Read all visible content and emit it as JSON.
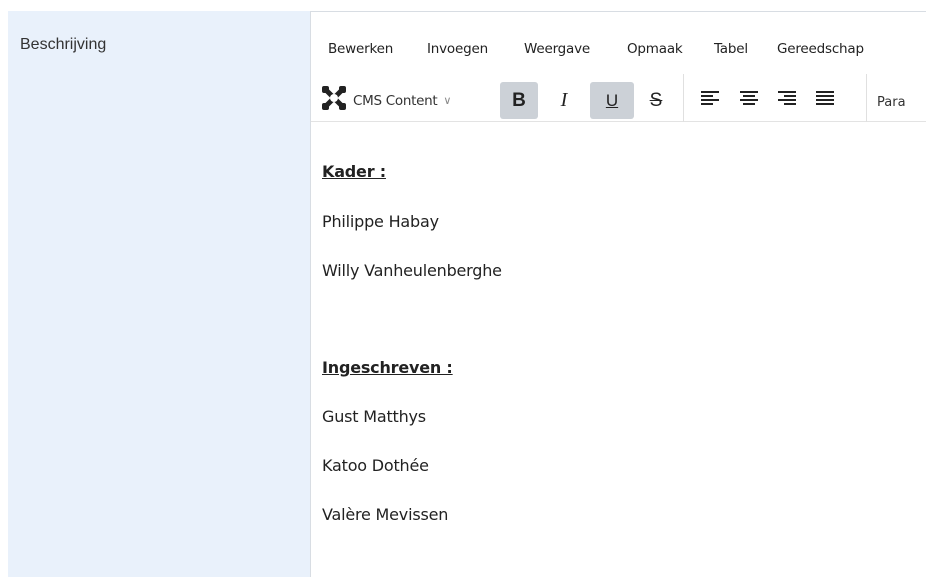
{
  "field": {
    "label": "Beschrijving"
  },
  "menubar": {
    "items": [
      "Bewerken",
      "Invoegen",
      "Weergave",
      "Opmaak",
      "Tabel",
      "Gereedschap"
    ]
  },
  "toolbar": {
    "cms_label": "CMS Content",
    "bold_label": "B",
    "italic_label": "I",
    "underline_label": "U",
    "strike_label": "S",
    "paragraph_label": "Para",
    "active_color": "#ccd1d7"
  },
  "content": {
    "heading1": "Kader :",
    "line1": "Philippe Habay",
    "line2": "Willy Vanheulenberghe",
    "heading2": "Ingeschreven :",
    "line3": "Gust Matthys",
    "line4": "Katoo Dothée",
    "line5": "Valère Mevissen"
  },
  "colors": {
    "label_bg": "#e9f1fb"
  }
}
